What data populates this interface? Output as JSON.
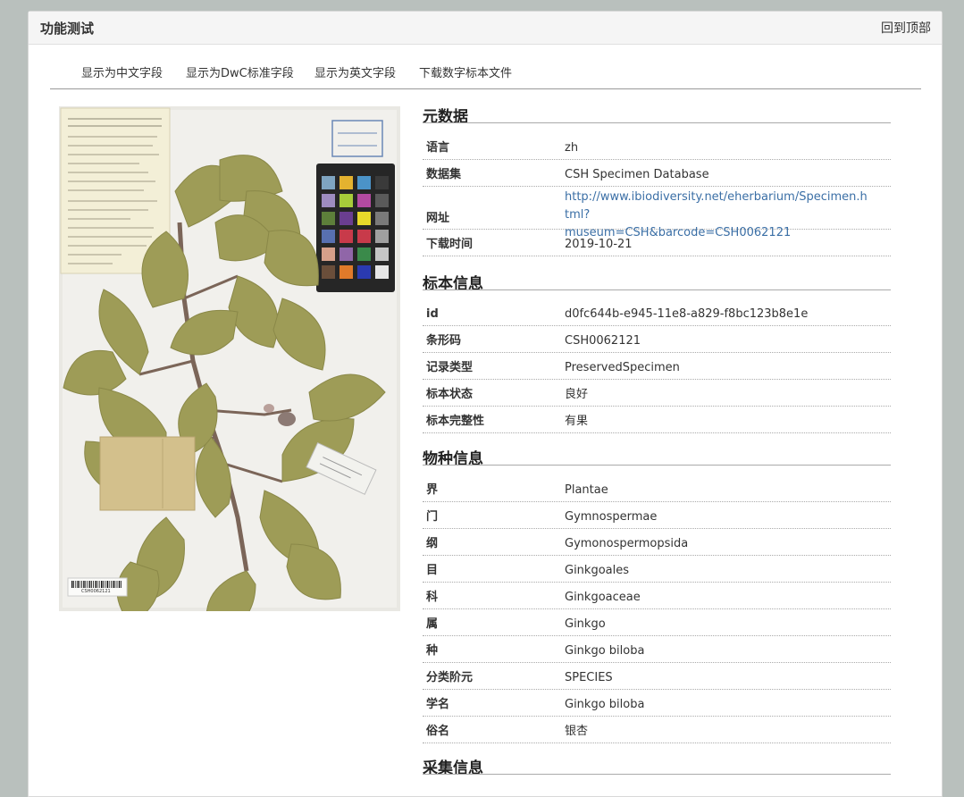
{
  "header": {
    "title": "功能测试",
    "back_to_top": "回到顶部"
  },
  "tabs": [
    {
      "label": "显示为中文字段"
    },
    {
      "label": "显示为DwC标准字段"
    },
    {
      "label": "显示为英文字段"
    },
    {
      "label": "下载数字标本文件"
    }
  ],
  "specimen_image": {
    "barcode_text": "CSH0062121"
  },
  "sections": [
    {
      "title": "元数据",
      "rows": [
        {
          "key": "语言",
          "value": "zh"
        },
        {
          "key": "数据集",
          "value": "CSH Specimen Database"
        },
        {
          "key": "网址",
          "value": "http://www.ibiodiversity.net/eherbarium/Specimen.html?museum=CSH&barcode=CSH0062121"
        },
        {
          "key": "下载时间",
          "value": "2019-10-21"
        }
      ]
    },
    {
      "title": "标本信息",
      "rows": [
        {
          "key": "id",
          "value": "d0fc644b-e945-11e8-a829-f8bc123b8e1e"
        },
        {
          "key": "条形码",
          "value": "CSH0062121"
        },
        {
          "key": "记录类型",
          "value": "PreservedSpecimen"
        },
        {
          "key": "标本状态",
          "value": "良好"
        },
        {
          "key": "标本完整性",
          "value": "有果"
        }
      ]
    },
    {
      "title": "物种信息",
      "rows": [
        {
          "key": "界",
          "value": "Plantae"
        },
        {
          "key": "门",
          "value": "Gymnospermae"
        },
        {
          "key": "纲",
          "value": "Gymonospermopsida"
        },
        {
          "key": "目",
          "value": "Ginkgoales"
        },
        {
          "key": "科",
          "value": "Ginkgoaceae"
        },
        {
          "key": "属",
          "value": "Ginkgo"
        },
        {
          "key": "种",
          "value": "Ginkgo biloba"
        },
        {
          "key": "分类阶元",
          "value": "SPECIES"
        },
        {
          "key": "学名",
          "value": "Ginkgo biloba"
        },
        {
          "key": "俗名",
          "value": "银杏"
        }
      ]
    },
    {
      "title": "采集信息",
      "rows": []
    }
  ],
  "colors": {
    "link": "#3b6fa6",
    "background": "#b9c0bd"
  }
}
